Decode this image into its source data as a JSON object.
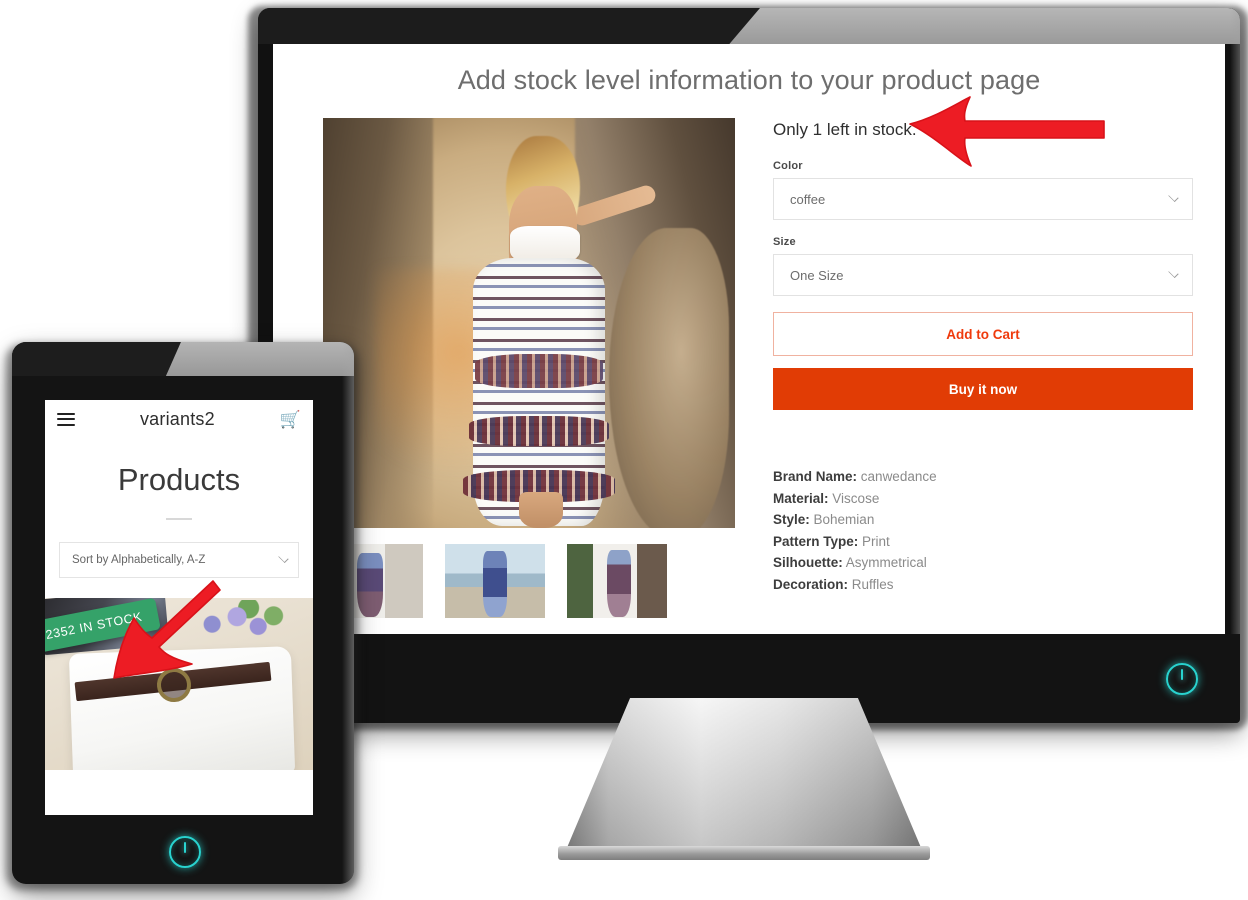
{
  "heading": "Add stock level information to your product page",
  "desktop": {
    "stock_message": "Only 1 left in stock.",
    "options": [
      {
        "label": "Color",
        "value": "coffee",
        "caret": "chevron-down-icon"
      },
      {
        "label": "Size",
        "value": "One Size",
        "caret": "chevron-down-icon"
      }
    ],
    "add_to_cart_label": "Add to Cart",
    "buy_it_now_label": "Buy it now",
    "specs": [
      {
        "key": "Brand Name:",
        "value": "canwedance"
      },
      {
        "key": "Material:",
        "value": "Viscose"
      },
      {
        "key": "Style:",
        "value": "Bohemian"
      },
      {
        "key": "Pattern Type:",
        "value": "Print"
      },
      {
        "key": "Silhouette:",
        "value": "Asymmetrical"
      },
      {
        "key": "Decoration:",
        "value": "Ruffles"
      }
    ],
    "thumbnails": [
      "product-thumbnail-1",
      "product-thumbnail-2",
      "product-thumbnail-3"
    ],
    "power_icon": "power-icon"
  },
  "tablet": {
    "menu_icon": "hamburger-menu-icon",
    "shop_name": "variants2",
    "cart_icon": "shopping-cart-icon",
    "page_title": "Products",
    "sort_value": "Sort by Alphabetically, A-Z",
    "sort_caret": "chevron-down-icon",
    "stock_badge": "2352 IN STOCK",
    "power_icon": "power-icon"
  },
  "annotations": {
    "desktop_arrow": "red-arrow-pointing-left",
    "tablet_arrow": "red-arrow-pointing-down-left"
  },
  "colors": {
    "accent_red": "#e13c05",
    "cart_text": "#ef3a0c",
    "stock_badge_green": "#35a269",
    "power_cyan": "#29d3cf",
    "arrow_red": "#ed1c24",
    "heading_gray": "#6e6e6e"
  }
}
